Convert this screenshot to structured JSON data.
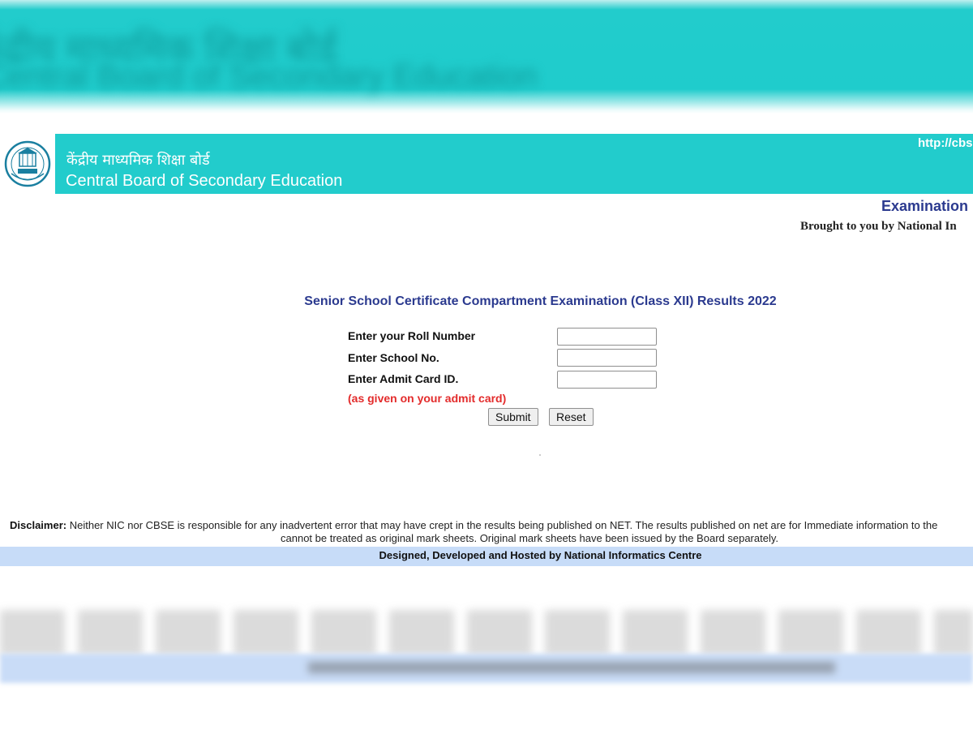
{
  "header": {
    "hindi_title": "केंद्रीय माध्यमिक शिक्षा बोर्ड",
    "english_title": "Central Board of Secondary Education",
    "site_url": "http://cbs",
    "exam_heading": "Examination",
    "brought_by": "Brought to you by National In"
  },
  "form": {
    "title": "Senior School Certificate Compartment Examination (Class XII) Results 2022",
    "fields": [
      {
        "label": "Enter your Roll Number",
        "value": ""
      },
      {
        "label": "Enter School No.",
        "value": ""
      },
      {
        "label": "Enter Admit Card ID.",
        "value": ""
      }
    ],
    "note": "(as given on your admit card)",
    "submit_label": "Submit",
    "reset_label": "Reset"
  },
  "footer": {
    "disclaimer_label": "Disclaimer:",
    "disclaimer_line1": "Neither NIC nor CBSE is responsible for any inadvertent error that may have crept in the results being published on NET. The results published on net are for Immediate information to the",
    "disclaimer_line2": "cannot be treated as original mark sheets. Original mark sheets have been issued by the Board separately.",
    "credits": "Designed, Developed and Hosted by National Informatics Centre"
  },
  "colors": {
    "header_teal": "#22cccc",
    "heading_blue": "#2b3a8f",
    "note_red": "#e32b2b",
    "footer_blue": "#c7dcf8"
  },
  "icons": {
    "logo": "cbse-emblem-icon"
  }
}
